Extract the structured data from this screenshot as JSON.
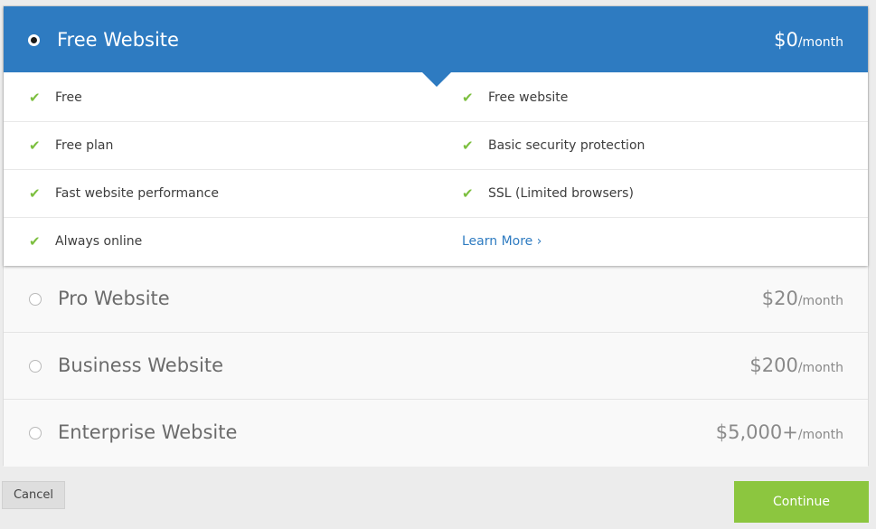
{
  "selected_plan": {
    "name": "Free Website",
    "price": "$0",
    "unit": "/month",
    "features": [
      {
        "left": "Free",
        "right": "Free website"
      },
      {
        "left": "Free plan",
        "right": "Basic security protection"
      },
      {
        "left": "Fast website performance",
        "right": "SSL (Limited browsers)"
      },
      {
        "left": "Always online",
        "right_link": "Learn More ›"
      }
    ]
  },
  "other_plans": [
    {
      "name": "Pro Website",
      "price": "$20",
      "unit": "/month"
    },
    {
      "name": "Business Website",
      "price": "$200",
      "unit": "/month"
    },
    {
      "name": "Enterprise Website",
      "price": "$5,000+",
      "unit": "/month"
    }
  ],
  "icons": {
    "check": "✔"
  },
  "buttons": {
    "cancel": "Cancel",
    "continue": "Continue"
  },
  "colors": {
    "accent_blue": "#2e7bc1",
    "check_green": "#7cbf3f",
    "continue_green": "#8cc63f"
  }
}
